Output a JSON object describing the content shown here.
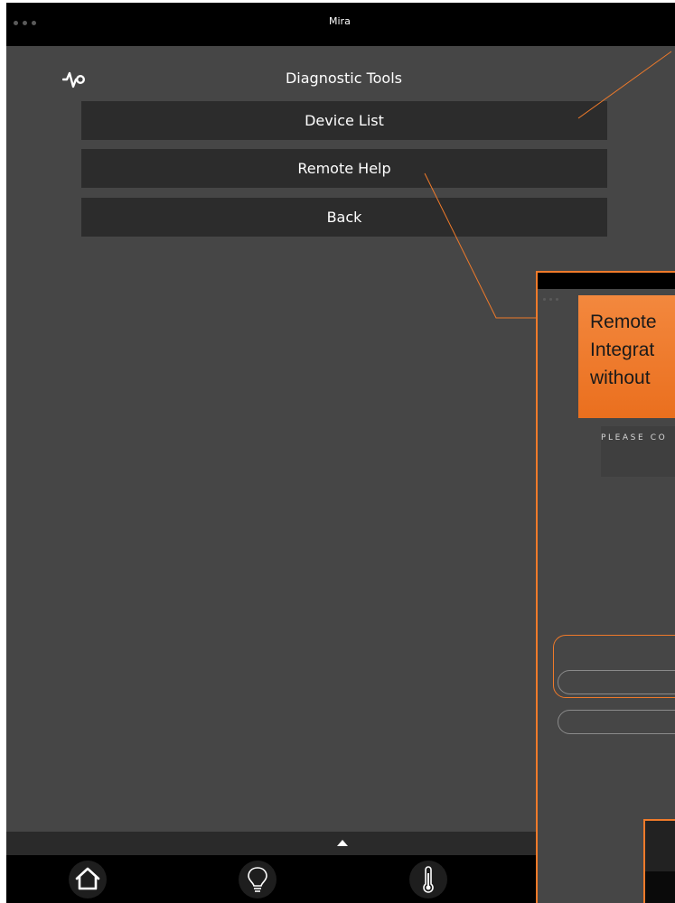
{
  "window": {
    "title": "Mira"
  },
  "page": {
    "title": "Diagnostic Tools",
    "header_icon": "pulse-icon"
  },
  "menu": {
    "items": [
      {
        "label": "Device List"
      },
      {
        "label": "Remote Help"
      },
      {
        "label": "Back"
      }
    ]
  },
  "tabbar": {
    "tabs": [
      {
        "icon": "home-icon"
      },
      {
        "icon": "lightbulb-icon"
      },
      {
        "icon": "thermometer-icon"
      }
    ]
  },
  "inset": {
    "callout_lines": [
      "Remote",
      "Integrat",
      "without"
    ],
    "please_text": "PLEASE CO"
  },
  "colors": {
    "background": "#464646",
    "button": "#2c2c2c",
    "titlebar": "#000000",
    "accent": "#ef7a2a"
  }
}
